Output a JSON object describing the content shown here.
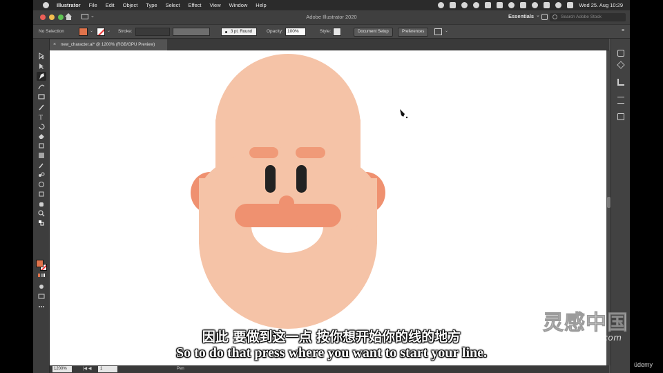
{
  "menubar": {
    "items": [
      "Illustrator",
      "File",
      "Edit",
      "Object",
      "Type",
      "Select",
      "Effect",
      "View",
      "Window",
      "Help"
    ],
    "clock": "Wed 25. Aug  10:29"
  },
  "appbar": {
    "title": "Adobe Illustrator 2020",
    "workspace": "Essentials",
    "search_placeholder": "Search Adobe Stock"
  },
  "control_panel": {
    "selection": "No Selection",
    "stroke_label": "Stroke:",
    "brush": "3 pt. Round",
    "opacity_label": "Opacity:",
    "opacity_value": "100%",
    "style_label": "Style:",
    "document_setup": "Document Setup",
    "preferences": "Preferences",
    "fill_color": "#e0734b"
  },
  "document_tab": {
    "close": "×",
    "title": "new_character.ai* @ 1200% (RGB/GPU Preview)"
  },
  "statusbar": {
    "zoom": "1200%",
    "nav": "|◀ ◀",
    "page": "1",
    "current_tool": "Pen"
  },
  "artwork": {
    "colors": {
      "skin": "#f5c3a7",
      "ear_inner": "#e26f45",
      "mustache": "#ef9170",
      "brow": "#f09a78",
      "eye": "#222222",
      "mouth": "#ffffff"
    }
  },
  "subtitles": {
    "zh": "因此 要做到这一点 按你想开始你的线的地方",
    "en": "So to do that press where you want to start your line."
  },
  "watermark": {
    "cn": "灵感中国",
    "en": "lingganchina.com"
  },
  "udemy": "üdemy"
}
